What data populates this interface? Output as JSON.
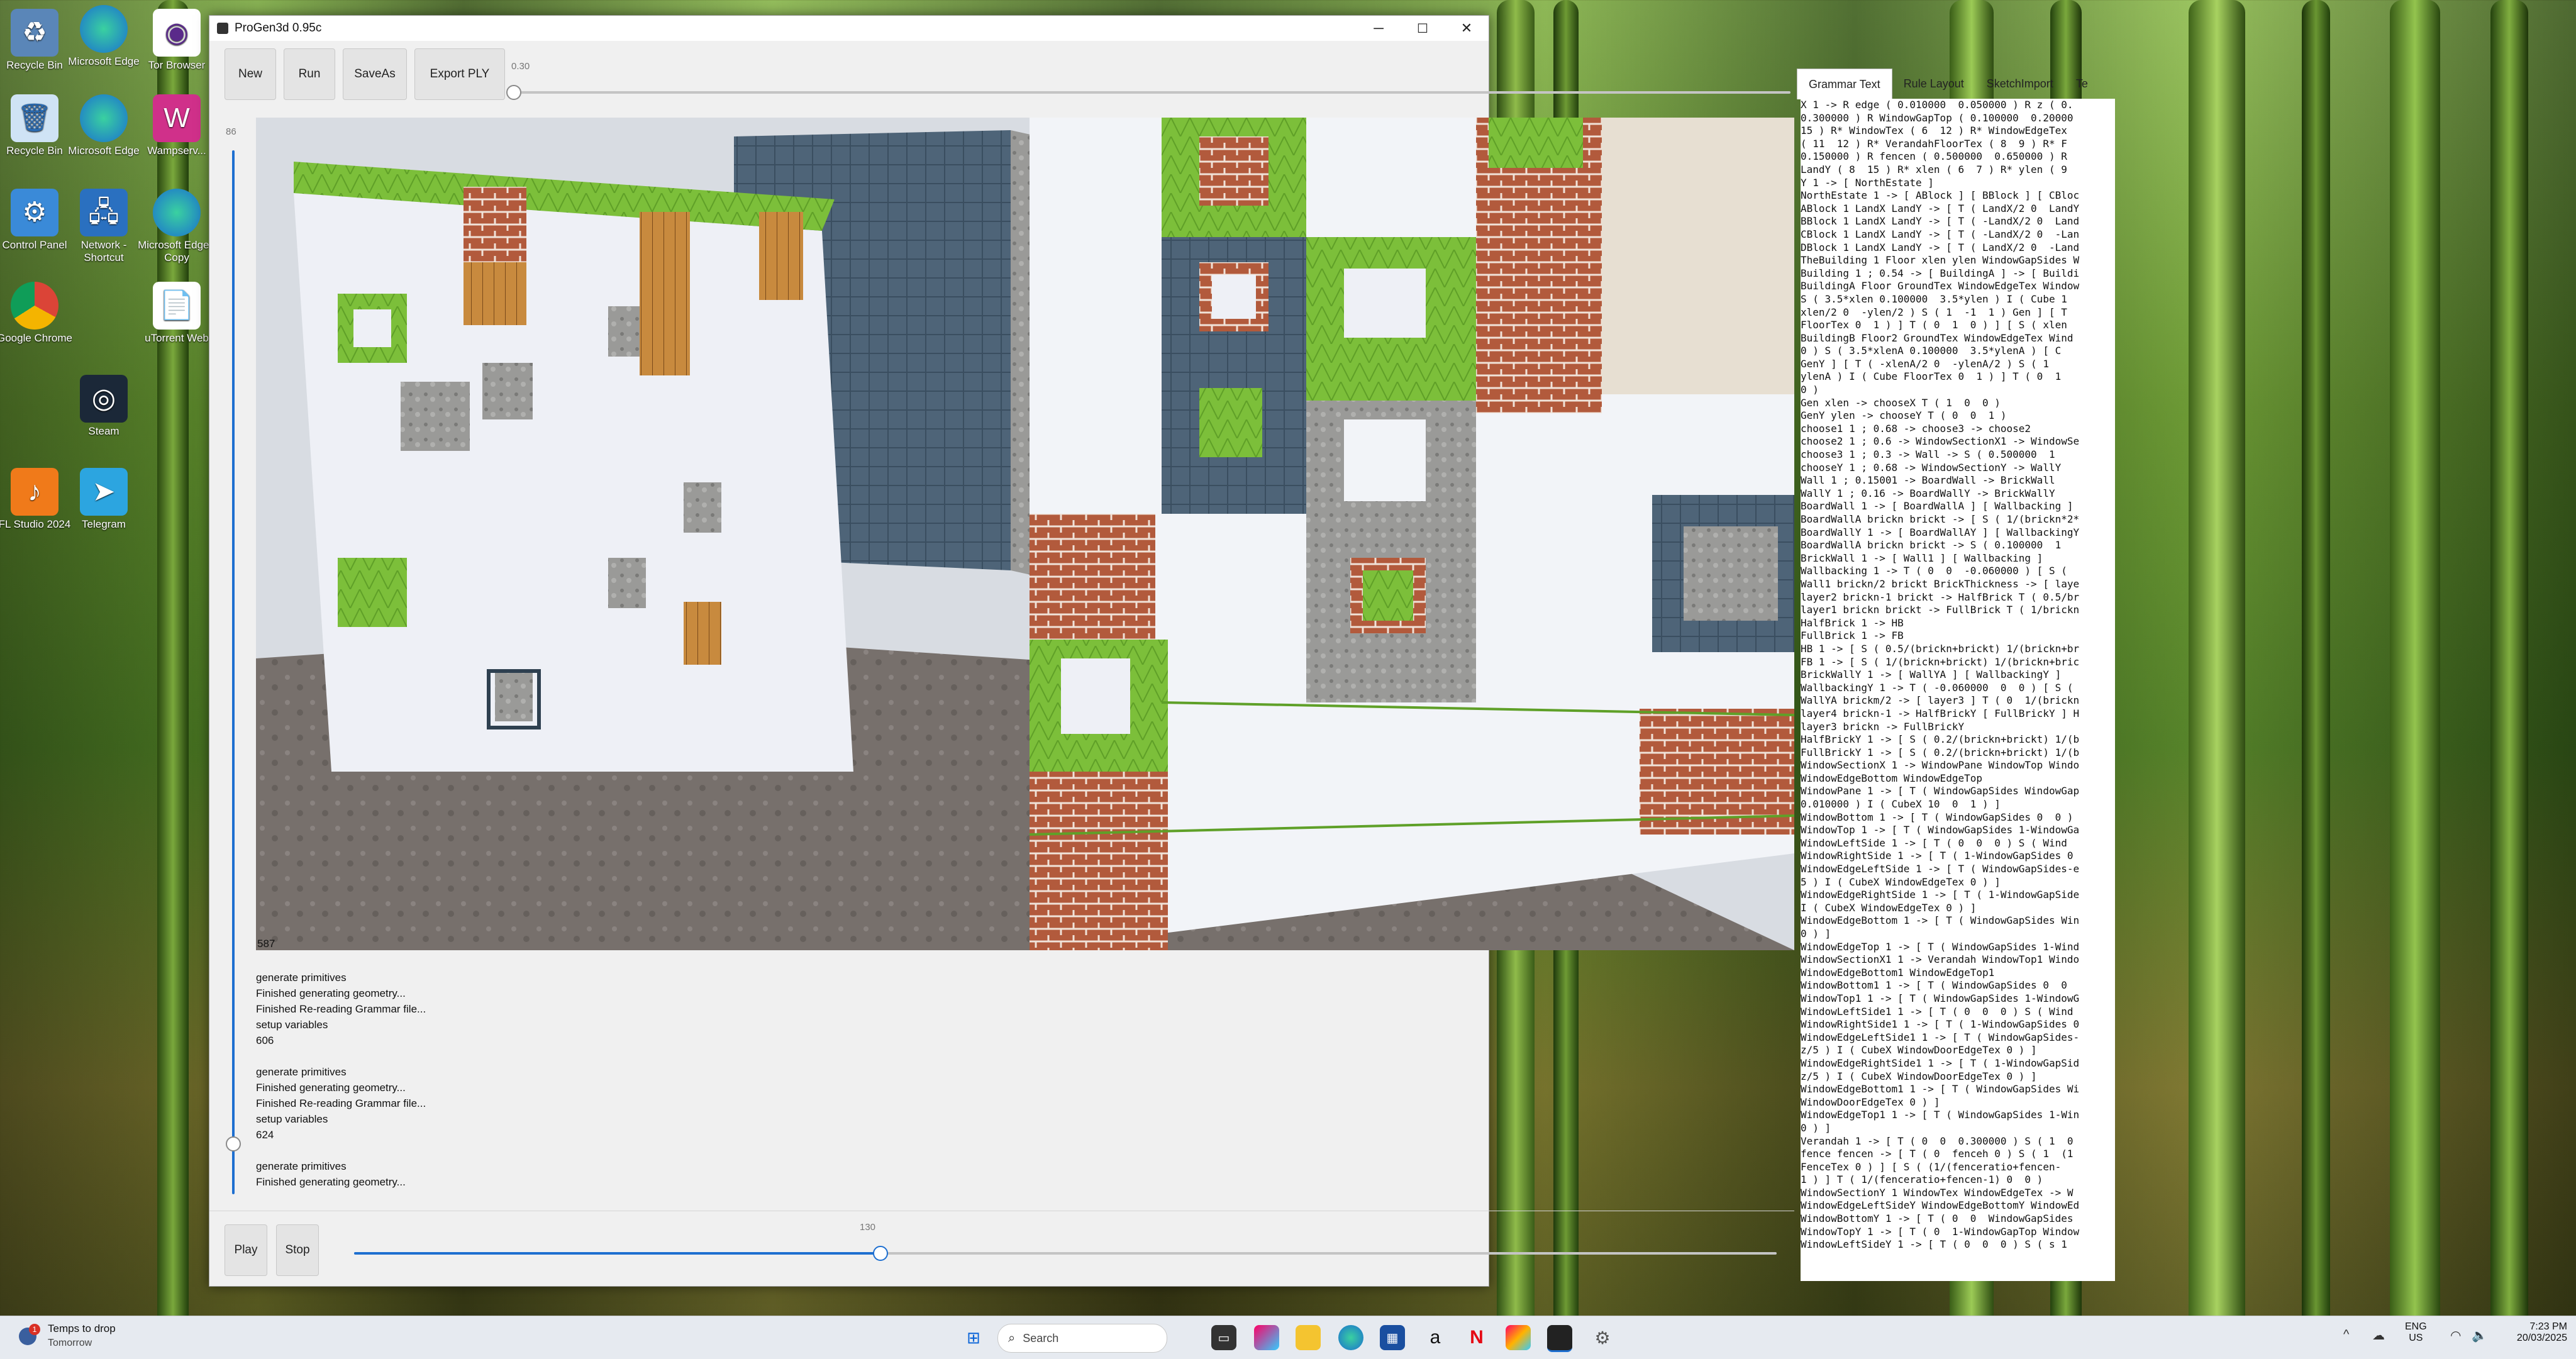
{
  "desktop": {
    "icons": [
      {
        "label": "Recycle Bin",
        "icon": "recycle-bin-icon"
      },
      {
        "label": "Microsoft Edge",
        "icon": "edge-icon"
      },
      {
        "label": "Tor Browser",
        "icon": "tor-browser-icon"
      },
      {
        "label": "Recycle Bin",
        "icon": "recycle-bin-icon"
      },
      {
        "label": "Microsoft Edge",
        "icon": "edge-icon"
      },
      {
        "label": "Wampserv...",
        "icon": "wampserver-icon"
      },
      {
        "label": "Control Panel",
        "icon": "control-panel-icon"
      },
      {
        "label": "Network - Shortcut",
        "icon": "network-icon"
      },
      {
        "label": "Microsoft Edge - Copy",
        "icon": "edge-icon"
      },
      {
        "label": "Google Chrome",
        "icon": "chrome-icon"
      },
      {
        "label": "uTorrent Web",
        "icon": "utorrent-icon"
      },
      {
        "label": "Steam",
        "icon": "steam-icon"
      },
      {
        "label": "FL Studio 2024",
        "icon": "fl-studio-icon"
      },
      {
        "label": "Telegram",
        "icon": "telegram-icon"
      }
    ]
  },
  "window": {
    "title": "ProGen3d 0.95c",
    "controls": {
      "minimize": "─",
      "maximize": "☐",
      "close": "✕"
    }
  },
  "toolbar": {
    "new_label": "New",
    "run_label": "Run",
    "saveas_label": "SaveAs",
    "export_label": "Export PLY",
    "top_slider_value": "0.30",
    "top_slider_fraction": 0.0
  },
  "vertical_slider": {
    "value": "86",
    "fraction": 0.14
  },
  "viewport": {
    "frame_counter": "587"
  },
  "log": {
    "lines": [
      "",
      "generate primitives",
      "Finished generating geometry...",
      "Finished Re-reading Grammar file...",
      "setup variables",
      "606",
      "",
      "generate primitives",
      "Finished generating geometry...",
      "Finished Re-reading Grammar file...",
      "setup variables",
      "624",
      "",
      "generate primitives",
      "Finished generating geometry..."
    ]
  },
  "playback": {
    "play_label": "Play",
    "stop_label": "Stop",
    "slider_value": "130",
    "slider_fraction": 0.37
  },
  "tabs": [
    {
      "label": "Grammar Text",
      "active": true
    },
    {
      "label": "Rule Layout",
      "active": false
    },
    {
      "label": "SketchImport",
      "active": false
    },
    {
      "label": "Te",
      "active": false
    }
  ],
  "grammar_lines": [
    "X 1 -> R edge ( 0.010000  0.050000 ) R z ( 0.",
    "0.300000 ) R WindowGapTop ( 0.100000  0.20000",
    "15 ) R* WindowTex ( 6  12 ) R* WindowEdgeTex",
    "( 11  12 ) R* VerandahFloorTex ( 8  9 ) R* F",
    "0.150000 ) R fencen ( 0.500000  0.650000 ) R",
    "LandY ( 8  15 ) R* xlen ( 6  7 ) R* ylen ( 9",
    "Y 1 -> [ NorthEstate ]",
    "NorthEstate 1 -> [ ABlock ] [ BBlock ] [ CBloc",
    "ABlock 1 LandX LandY -> [ T ( LandX/2 0  LandY",
    "BBlock 1 LandX LandY -> [ T ( -LandX/2 0  Land",
    "CBlock 1 LandX LandY -> [ T ( -LandX/2 0  -Lan",
    "DBlock 1 LandX LandY -> [ T ( LandX/2 0  -Land",
    "TheBuilding 1 Floor xlen ylen WindowGapSides W",
    "Building 1 ; 0.54 -> [ BuildingA ] -> [ Buildi",
    "BuildingA Floor GroundTex WindowEdgeTex Window",
    "S ( 3.5*xlen 0.100000  3.5*ylen ) I ( Cube 1",
    "xlen/2 0  -ylen/2 ) S ( 1  -1  1 ) Gen ] [ T",
    "FloorTex 0  1 ) ] T ( 0  1  0 ) ] [ S ( xlen",
    "BuildingB Floor2 GroundTex WindowEdgeTex Wind",
    "0 ) S ( 3.5*xlenA 0.100000  3.5*ylenA ) [ C",
    "GenY ] [ T ( -xlenA/2 0  -ylenA/2 ) S ( 1",
    "ylenA ) I ( Cube FloorTex 0  1 ) ] T ( 0  1",
    "0 )",
    "Gen xlen -> chooseX T ( 1  0  0 )",
    "GenY ylen -> chooseY T ( 0  0  1 )",
    "choose1 1 ; 0.68 -> choose3 -> choose2",
    "choose2 1 ; 0.6 -> WindowSectionX1 -> WindowSe",
    "choose3 1 ; 0.3 -> Wall -> S ( 0.500000  1",
    "chooseY 1 ; 0.68 -> WindowSectionY -> WallY",
    "Wall 1 ; 0.15001 -> BoardWall -> BrickWall",
    "WallY 1 ; 0.16 -> BoardWallY -> BrickWallY",
    "BoardWall 1 -> [ BoardWallA ] [ Wallbacking ]",
    "BoardWallA brickn brickt -> [ S ( 1/(brickn*2*",
    "BoardWallY 1 -> [ BoardWallAY ] [ WallbackingY",
    "BoardWallA brickn brickt -> S ( 0.100000  1",
    "BrickWall 1 -> [ Wall1 ] [ Wallbacking ]",
    "Wallbacking 1 -> T ( 0  0  -0.060000 ) [ S (",
    "Wall1 brickn/2 brickt BrickThickness -> [ laye",
    "layer2 brickn-1 brickt -> HalfBrick T ( 0.5/br",
    "layer1 brickn brickt -> FullBrick T ( 1/brickn",
    "HalfBrick 1 -> HB",
    "FullBrick 1 -> FB",
    "HB 1 -> [ S ( 0.5/(brickn+brickt) 1/(brickn+br",
    "FB 1 -> [ S ( 1/(brickn+brickt) 1/(brickn+bric",
    "BrickWallY 1 -> [ WallYA ] [ WallbackingY ]",
    "WallbackingY 1 -> T ( -0.060000  0  0 ) [ S (",
    "WallYA brickm/2 -> [ layer3 ] T ( 0  1/(brickn",
    "layer4 brickn-1 -> HalfBrickY [ FullBrickY ] H",
    "layer3 brickn -> FullBrickY",
    "HalfBrickY 1 -> [ S ( 0.2/(brickn+brickt) 1/(b",
    "FullBrickY 1 -> [ S ( 0.2/(brickn+brickt) 1/(b",
    "WindowSectionX 1 -> WindowPane WindowTop Windo",
    "WindowEdgeBottom WindowEdgeTop",
    "WindowPane 1 -> [ T ( WindowGapSides WindowGap",
    "0.010000 ) I ( CubeX 10  0  1 ) ]",
    "WindowBottom 1 -> [ T ( WindowGapSides 0  0 )",
    "WindowTop 1 -> [ T ( WindowGapSides 1-WindowGa",
    "WindowLeftSide 1 -> [ T ( 0  0  0 ) S ( Wind",
    "WindowRightSide 1 -> [ T ( 1-WindowGapSides 0",
    "WindowEdgeLeftSide 1 -> [ T ( WindowGapSides-e",
    "5 ) I ( CubeX WindowEdgeTex 0 ) ]",
    "WindowEdgeRightSide 1 -> [ T ( 1-WindowGapSide",
    "I ( CubeX WindowEdgeTex 0 ) ]",
    "WindowEdgeBottom 1 -> [ T ( WindowGapSides Win",
    "0 ) ]",
    "WindowEdgeTop 1 -> [ T ( WindowGapSides 1-Wind",
    "WindowSectionX1 1 -> Verandah WindowTop1 Windo",
    "WindowEdgeBottom1 WindowEdgeTop1",
    "WindowBottom1 1 -> [ T ( WindowGapSides 0  0",
    "WindowTop1 1 -> [ T ( WindowGapSides 1-WindowG",
    "WindowLeftSide1 1 -> [ T ( 0  0  0 ) S ( Wind",
    "WindowRightSide1 1 -> [ T ( 1-WindowGapSides 0",
    "WindowEdgeLeftSide1 1 -> [ T ( WindowGapSides-",
    "z/5 ) I ( CubeX WindowDoorEdgeTex 0 ) ]",
    "WindowEdgeRightSide1 1 -> [ T ( 1-WindowGapSid",
    "z/5 ) I ( CubeX WindowDoorEdgeTex 0 ) ]",
    "WindowEdgeBottom1 1 -> [ T ( WindowGapSides Wi",
    "WindowDoorEdgeTex 0 ) ]",
    "WindowEdgeTop1 1 -> [ T ( WindowGapSides 1-Win",
    "0 ) ]",
    "Verandah 1 -> [ T ( 0  0  0.300000 ) S ( 1  0",
    "fence fencen -> [ T ( 0  fenceh 0 ) S ( 1  (1",
    "FenceTex 0 ) ] [ S ( (1/(fenceratio+fencen-",
    "1 ) ] T ( 1/(fenceratio+fencen-1) 0  0 )",
    "WindowSectionY 1 WindowTex WindowEdgeTex -> W",
    "WindowEdgeLeftSideY WindowEdgeBottomY WindowEd",
    "WindowBottomY 1 -> [ T ( 0  0  WindowGapSides",
    "WindowTopY 1 -> [ T ( 0  1-WindowGapTop Window",
    "WindowLeftSideY 1 -> [ T ( 0  0  0 ) S ( s 1"
  ],
  "taskbar": {
    "weather_title": "Temps to drop",
    "weather_sub": "Tomorrow",
    "weather_badge": "1",
    "search_placeholder": "Search",
    "lang_top": "ENG",
    "lang_bottom": "US",
    "time": "7:23 PM",
    "date": "20/03/2025"
  }
}
